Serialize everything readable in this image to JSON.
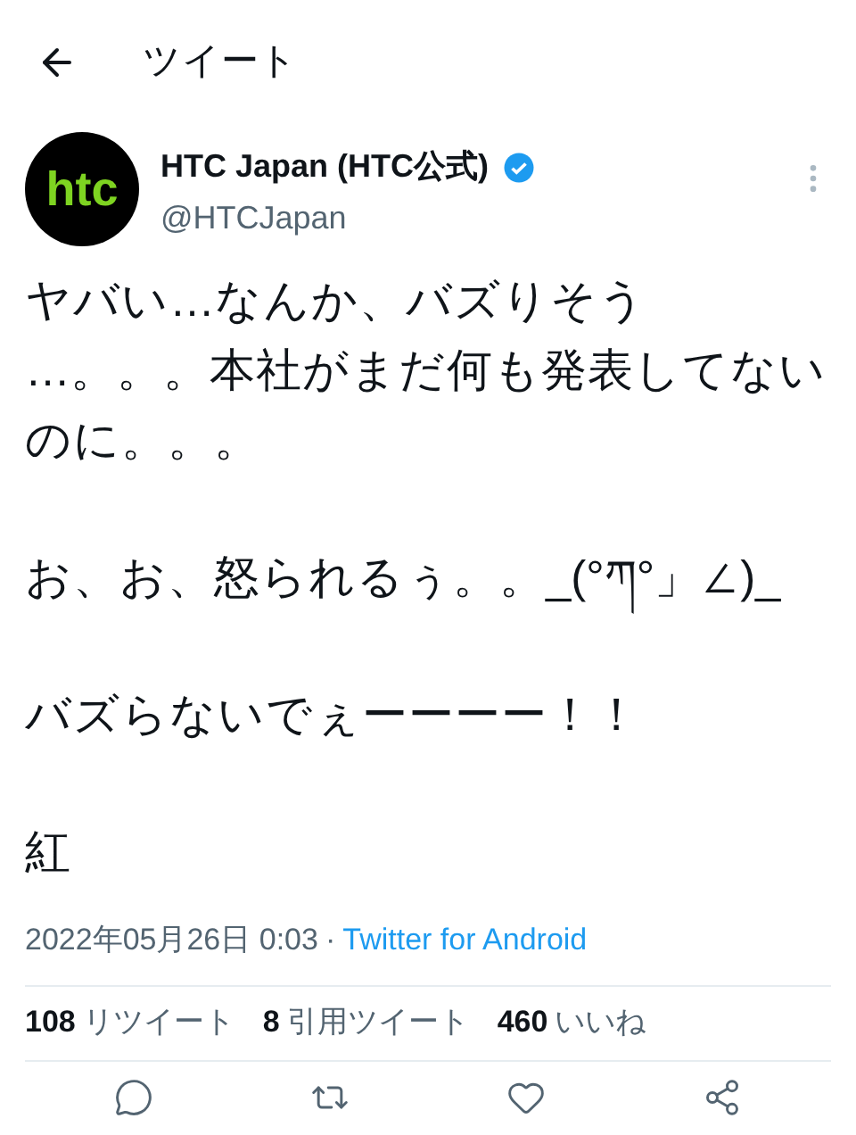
{
  "header": {
    "title": "ツイート"
  },
  "author": {
    "name": "HTC Japan (HTC公式)",
    "verified": true,
    "handle": "@HTCJapan",
    "avatar_text": "htc"
  },
  "tweet": {
    "paragraphs": [
      "ヤバい…なんか、バズりそう\n…。。。本社がまだ何も発表してないのに。。。",
      "お、お、怒られるぅ。。_(°ཀ°」∠)_",
      "バズらないでぇーーーー！！",
      "紅"
    ],
    "timestamp": "2022年05月26日 0:03",
    "separator": "·",
    "source": "Twitter for Android"
  },
  "stats": [
    {
      "count": "108",
      "label": "リツイート"
    },
    {
      "count": "8",
      "label": "引用ツイート"
    },
    {
      "count": "460",
      "label": "いいね"
    }
  ]
}
